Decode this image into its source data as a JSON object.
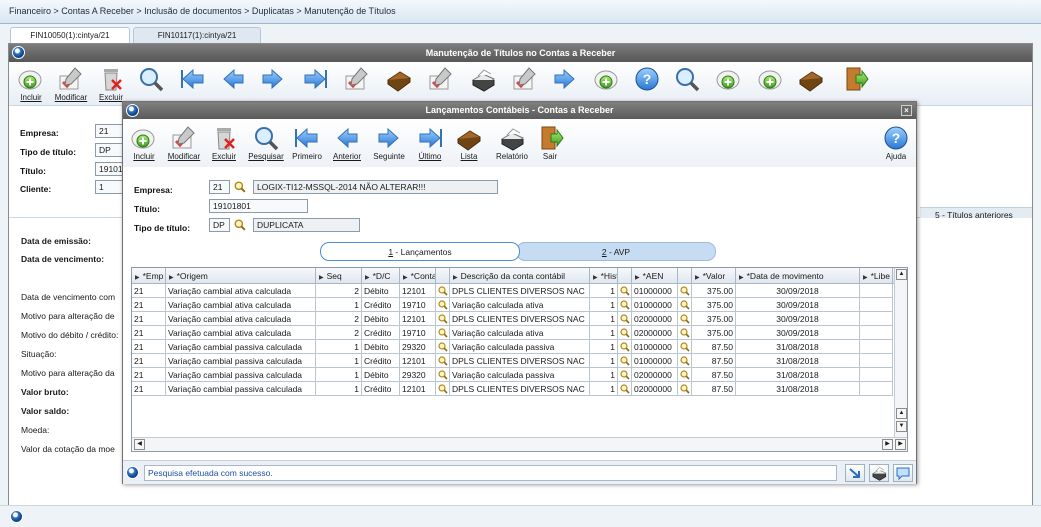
{
  "breadcrumb": "Financeiro > Contas A Receber > Inclusão de documentos > Duplicatas > Manutenção de Títulos",
  "tabs": [
    {
      "label": "FIN10050(1):cintya/21",
      "active": true
    },
    {
      "label": "FIN10117(1):cintya/21",
      "active": false
    }
  ],
  "main_window": {
    "title": "Manutenção de Títulos no Contas a Receber",
    "toolbar": [
      {
        "label": "Incluir",
        "icon": "add-doc-icon"
      },
      {
        "label": "Modificar",
        "icon": "edit-check-icon"
      },
      {
        "label": "Excluir",
        "icon": "trash-icon"
      }
    ],
    "form": {
      "empresa_label": "Empresa:",
      "empresa_value": "21",
      "tipo_label": "Tipo de título:",
      "tipo_value": "DP",
      "titulo_label": "Título:",
      "titulo_value": "19101",
      "cliente_label": "Cliente:",
      "cliente_value": "1"
    },
    "section_labels": [
      {
        "text": "Data de emissão:",
        "bold": true
      },
      {
        "text": "Data de vencimento:",
        "bold": true
      },
      {
        "text": "Data de vencimento com",
        "bold": false
      },
      {
        "text": "Motivo para alteração de",
        "bold": false
      },
      {
        "text": "Motivo do débito / crédito:",
        "bold": false
      },
      {
        "text": "Situação:",
        "bold": false
      },
      {
        "text": "Motivo para alteração da",
        "bold": false
      },
      {
        "text": "Valor bruto:",
        "bold": true
      },
      {
        "text": "Valor saldo:",
        "bold": true
      },
      {
        "text": "Moeda:",
        "bold": false
      },
      {
        "text": "Valor da cotação da moe",
        "bold": false
      }
    ],
    "right_link": "5 - Títulos anteriores"
  },
  "modal": {
    "title": "Lançamentos Contábeis - Contas a Receber",
    "toolbar": [
      {
        "label": "Incluir",
        "icon": "add-doc-icon"
      },
      {
        "label": "Modificar",
        "icon": "edit-check-icon"
      },
      {
        "label": "Excluir",
        "icon": "trash-icon"
      },
      {
        "label": "Pesquisar",
        "icon": "magnifier-icon"
      },
      {
        "label": "Primeiro",
        "icon": "first-arrow-icon"
      },
      {
        "label": "Anterior",
        "icon": "prev-arrow-icon"
      },
      {
        "label": "Seguinte",
        "icon": "next-arrow-icon"
      },
      {
        "label": "Último",
        "icon": "last-arrow-icon"
      },
      {
        "label": "Lista",
        "icon": "book-icon"
      },
      {
        "label": "Relatório",
        "icon": "printer-icon"
      },
      {
        "label": "Sair",
        "icon": "exit-door-icon"
      }
    ],
    "help_label": "Ajuda",
    "form": {
      "empresa_label": "Empresa:",
      "empresa_code": "21",
      "empresa_desc": "LOGIX-TI12-MSSQL-2014 NÃO ALTERAR!!!",
      "titulo_label": "Título:",
      "titulo_value": "19101801",
      "tipo_label": "Tipo de título:",
      "tipo_code": "DP",
      "tipo_desc": "DUPLICATA"
    },
    "subtabs": [
      {
        "key": "1",
        "label": " - Lançamentos",
        "active": true
      },
      {
        "key": "2",
        "label": " - AVP",
        "active": false
      }
    ],
    "grid": {
      "headers": [
        "*Emp",
        "*Origem",
        "Seq",
        "*D/C",
        "*Conta",
        "",
        "Descrição da conta contábil",
        "*Hist",
        "",
        "*AEN",
        "",
        "*Valor",
        "*Data de movimento",
        "*Libe"
      ],
      "rows": [
        [
          "21",
          "Variação cambial ativa calculada",
          "2",
          "Débito",
          "12101",
          "DPLS CLIENTES DIVERSOS NAC",
          "1",
          "01000000",
          "375.00",
          "30/09/2018"
        ],
        [
          "21",
          "Variação cambial ativa calculada",
          "1",
          "Crédito",
          "19710",
          "Variação calculada ativa",
          "1",
          "01000000",
          "375.00",
          "30/09/2018"
        ],
        [
          "21",
          "Variação cambial ativa calculada",
          "2",
          "Débito",
          "12101",
          "DPLS CLIENTES DIVERSOS NAC",
          "1",
          "02000000",
          "375.00",
          "30/09/2018"
        ],
        [
          "21",
          "Variação cambial ativa calculada",
          "2",
          "Crédito",
          "19710",
          "Variação calculada ativa",
          "1",
          "02000000",
          "375.00",
          "30/09/2018"
        ],
        [
          "21",
          "Variação cambial passiva calculada",
          "1",
          "Débito",
          "29320",
          "Variação calculada passiva",
          "1",
          "01000000",
          "87.50",
          "31/08/2018"
        ],
        [
          "21",
          "Variação cambial passiva calculada",
          "1",
          "Crédito",
          "12101",
          "DPLS CLIENTES DIVERSOS NAC",
          "1",
          "01000000",
          "87.50",
          "31/08/2018"
        ],
        [
          "21",
          "Variação cambial passiva calculada",
          "1",
          "Débito",
          "29320",
          "Variação calculada passiva",
          "1",
          "02000000",
          "87.50",
          "31/08/2018"
        ],
        [
          "21",
          "Variação cambial passiva calculada",
          "1",
          "Crédito",
          "12101",
          "DPLS CLIENTES DIVERSOS NAC",
          "1",
          "02000000",
          "87.50",
          "31/08/2018"
        ]
      ]
    },
    "status_message": "Pesquisa efetuada com sucesso."
  }
}
